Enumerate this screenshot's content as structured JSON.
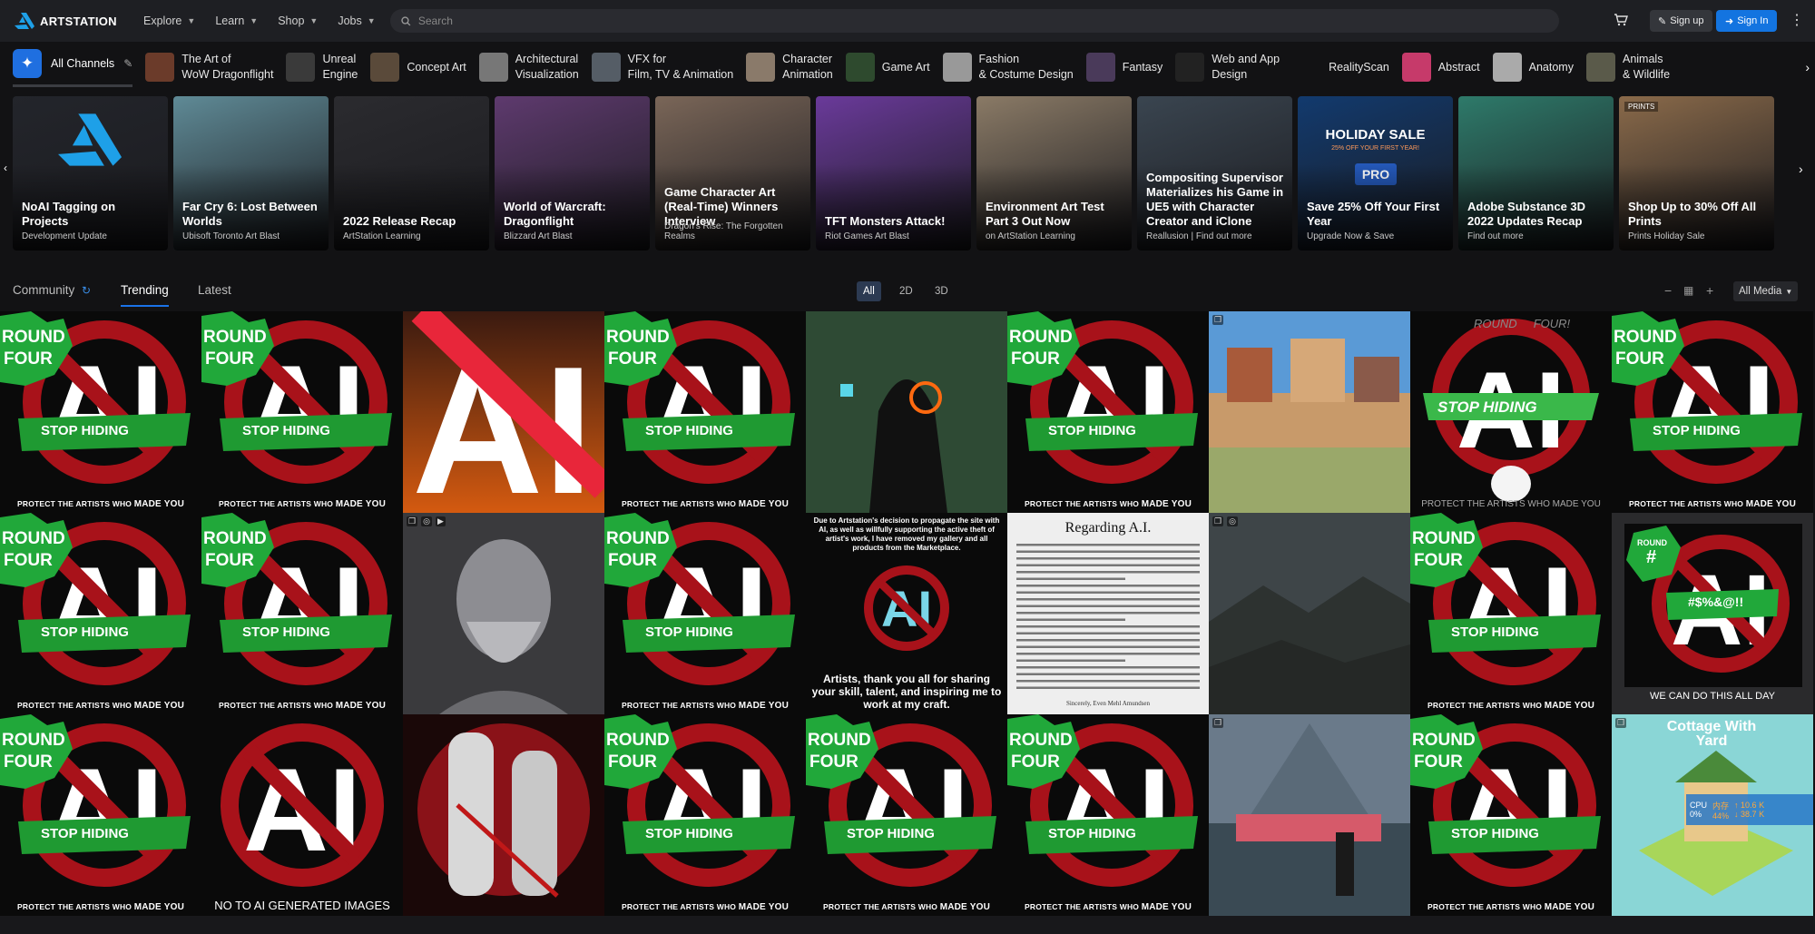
{
  "brand": {
    "name": "ARTSTATION"
  },
  "nav": {
    "items": [
      {
        "label": "Explore"
      },
      {
        "label": "Learn"
      },
      {
        "label": "Shop"
      },
      {
        "label": "Jobs"
      }
    ],
    "search_placeholder": "Search",
    "signup_label": "Sign up",
    "signin_label": "Sign In"
  },
  "channels": {
    "all_label": "All Channels",
    "items": [
      {
        "label": "The Art of\nWoW Dragonflight",
        "color": "#6b3b2a"
      },
      {
        "label": "Unreal\nEngine",
        "color": "#3a3a3a"
      },
      {
        "label": "Concept Art",
        "color": "#5a4a3a"
      },
      {
        "label": "Architectural\nVisualization",
        "color": "#777"
      },
      {
        "label": "VFX for\nFilm, TV & Animation",
        "color": "#555d66"
      },
      {
        "label": "Character\nAnimation",
        "color": "#8a7a6a"
      },
      {
        "label": "Game Art",
        "color": "#2e4a2e"
      },
      {
        "label": "Fashion\n& Costume Design",
        "color": "#999"
      },
      {
        "label": "Fantasy",
        "color": "#4a3a5a"
      },
      {
        "label": "Web and App\nDesign",
        "color": "#222"
      },
      {
        "label": "RealityScan",
        "color": "#121214"
      },
      {
        "label": "Abstract",
        "color": "#c63a6a"
      },
      {
        "label": "Anatomy",
        "color": "#aaa"
      },
      {
        "label": "Animals\n& Wildlife",
        "color": "#5a5a4a"
      }
    ]
  },
  "featured": [
    {
      "title": "NoAI Tagging on Projects",
      "sub": "Development Update",
      "bg": "#23252b"
    },
    {
      "title": "Far Cry 6: Lost Between Worlds",
      "sub": "Ubisoft Toronto Art Blast",
      "bg": "#5f8a96"
    },
    {
      "title": "2022 Release Recap",
      "sub": "ArtStation Learning",
      "bg": "#2b2b2f"
    },
    {
      "title": "World of Warcraft: Dragonflight",
      "sub": "Blizzard Art Blast",
      "bg": "#5e3a6e"
    },
    {
      "title": "Game Character Art (Real-Time) Winners Interview",
      "sub": "Dragon's Rise: The Forgotten Realms",
      "bg": "#7a6658"
    },
    {
      "title": "TFT Monsters Attack!",
      "sub": "Riot Games Art Blast",
      "bg": "#6a3a9a"
    },
    {
      "title": "Environment Art Test Part 3 Out Now",
      "sub": "on ArtStation Learning",
      "bg": "#8a7a66"
    },
    {
      "title": "Compositing Supervisor Materializes his Game in UE5 with Character Creator and iClone",
      "sub": "Reallusion | Find out more",
      "bg": "#3a4550"
    },
    {
      "title": "Save 25% Off Your First Year",
      "sub": "Upgrade Now & Save",
      "bg": "#123a6e",
      "promo_title": "HOLIDAY SALE",
      "promo_sub": "25% OFF YOUR FIRST YEAR!",
      "promo_badge": "PRO"
    },
    {
      "title": "Adobe Substance 3D 2022 Updates Recap",
      "sub": "Find out more",
      "bg": "#2e7a6a"
    },
    {
      "title": "Shop Up to 30% Off All Prints",
      "sub": "Prints Holiday Sale",
      "bg": "#8a6a4a",
      "tag": "PRINTS"
    }
  ],
  "filters": {
    "tabs": [
      "Community",
      "Trending",
      "Latest"
    ],
    "active_tab": "Trending",
    "segments": [
      "All",
      "2D",
      "3D"
    ],
    "active_segment": "All",
    "media_label": "All Media"
  },
  "poster_text": {
    "round": "ROUND",
    "four": "FOUR",
    "stop": "STOP HIDING",
    "caption_pre": "PROTECT THE ARTISTS WHO ",
    "caption_bold": "MADE YOU",
    "no_ai": "NO TO AI GENERATED IMAGES",
    "we_can": "WE CAN DO THIS ALL DAY",
    "round_hash": "#",
    "curse": "#$%&@!!",
    "stop_hiding_alt": "STOP HIDING",
    "round_four_alt": "ROUND     FOUR!",
    "protect_alt": "PROTECT THE ARTISTS WHO MADE YOU",
    "regarding_title": "Regarding A.I.",
    "regarding_sign": "Sincerely, Even Mehl Amundsen",
    "statement_top": "Due to Artstation's decision to propagate the site with AI, as well as willfully supporting the active theft of artist's work, I have removed my gallery and all products from the Marketplace.",
    "statement_bottom": "Artists, thank you all for sharing your skill, talent, and inspiring me to work at my craft.",
    "cottage": "Cottage With Yard",
    "cpu_label": "CPU",
    "cpu_value": "0%",
    "mem_label": "内存",
    "mem_value": "44%",
    "up": "10.6 K",
    "down": "38.7 K"
  },
  "grid_layout": [
    "poster",
    "poster",
    "ai-slash",
    "poster",
    "hoodie",
    "poster",
    "village",
    "rabbit",
    "poster",
    "poster",
    "poster",
    "bust",
    "poster",
    "statement",
    "regarding",
    "landscape",
    "poster",
    "round-hash",
    "poster",
    "no-ai",
    "warriors",
    "poster",
    "poster",
    "poster",
    "festival",
    "poster",
    "cottage"
  ],
  "colors": {
    "accent": "#1374e0",
    "poster_green": "#1f9a32",
    "poster_red": "#b3121b"
  }
}
